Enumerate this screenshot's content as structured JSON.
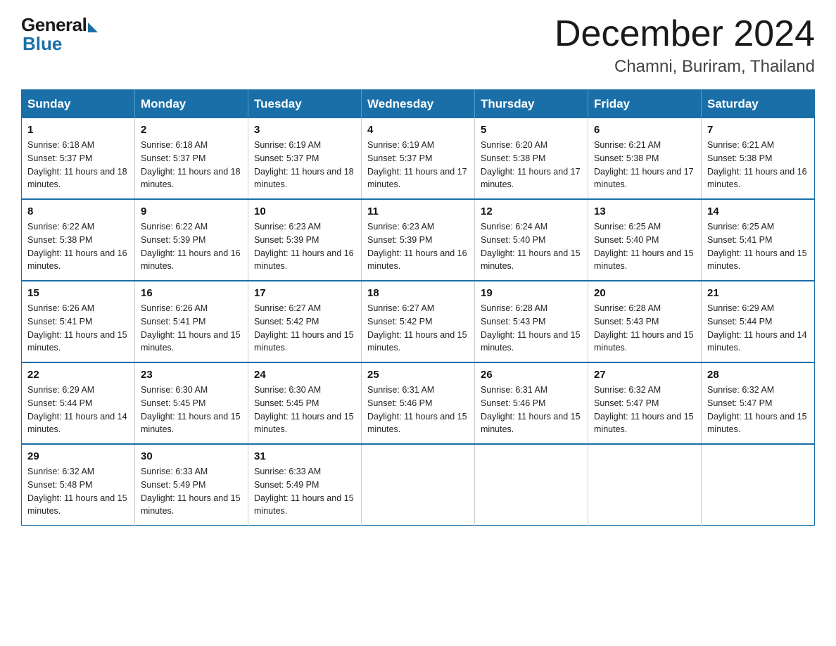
{
  "logo": {
    "general": "General",
    "blue": "Blue"
  },
  "header": {
    "month": "December 2024",
    "location": "Chamni, Buriram, Thailand"
  },
  "weekdays": [
    "Sunday",
    "Monday",
    "Tuesday",
    "Wednesday",
    "Thursday",
    "Friday",
    "Saturday"
  ],
  "weeks": [
    [
      {
        "day": "1",
        "sunrise": "6:18 AM",
        "sunset": "5:37 PM",
        "daylight": "11 hours and 18 minutes."
      },
      {
        "day": "2",
        "sunrise": "6:18 AM",
        "sunset": "5:37 PM",
        "daylight": "11 hours and 18 minutes."
      },
      {
        "day": "3",
        "sunrise": "6:19 AM",
        "sunset": "5:37 PM",
        "daylight": "11 hours and 18 minutes."
      },
      {
        "day": "4",
        "sunrise": "6:19 AM",
        "sunset": "5:37 PM",
        "daylight": "11 hours and 17 minutes."
      },
      {
        "day": "5",
        "sunrise": "6:20 AM",
        "sunset": "5:38 PM",
        "daylight": "11 hours and 17 minutes."
      },
      {
        "day": "6",
        "sunrise": "6:21 AM",
        "sunset": "5:38 PM",
        "daylight": "11 hours and 17 minutes."
      },
      {
        "day": "7",
        "sunrise": "6:21 AM",
        "sunset": "5:38 PM",
        "daylight": "11 hours and 16 minutes."
      }
    ],
    [
      {
        "day": "8",
        "sunrise": "6:22 AM",
        "sunset": "5:38 PM",
        "daylight": "11 hours and 16 minutes."
      },
      {
        "day": "9",
        "sunrise": "6:22 AM",
        "sunset": "5:39 PM",
        "daylight": "11 hours and 16 minutes."
      },
      {
        "day": "10",
        "sunrise": "6:23 AM",
        "sunset": "5:39 PM",
        "daylight": "11 hours and 16 minutes."
      },
      {
        "day": "11",
        "sunrise": "6:23 AM",
        "sunset": "5:39 PM",
        "daylight": "11 hours and 16 minutes."
      },
      {
        "day": "12",
        "sunrise": "6:24 AM",
        "sunset": "5:40 PM",
        "daylight": "11 hours and 15 minutes."
      },
      {
        "day": "13",
        "sunrise": "6:25 AM",
        "sunset": "5:40 PM",
        "daylight": "11 hours and 15 minutes."
      },
      {
        "day": "14",
        "sunrise": "6:25 AM",
        "sunset": "5:41 PM",
        "daylight": "11 hours and 15 minutes."
      }
    ],
    [
      {
        "day": "15",
        "sunrise": "6:26 AM",
        "sunset": "5:41 PM",
        "daylight": "11 hours and 15 minutes."
      },
      {
        "day": "16",
        "sunrise": "6:26 AM",
        "sunset": "5:41 PM",
        "daylight": "11 hours and 15 minutes."
      },
      {
        "day": "17",
        "sunrise": "6:27 AM",
        "sunset": "5:42 PM",
        "daylight": "11 hours and 15 minutes."
      },
      {
        "day": "18",
        "sunrise": "6:27 AM",
        "sunset": "5:42 PM",
        "daylight": "11 hours and 15 minutes."
      },
      {
        "day": "19",
        "sunrise": "6:28 AM",
        "sunset": "5:43 PM",
        "daylight": "11 hours and 15 minutes."
      },
      {
        "day": "20",
        "sunrise": "6:28 AM",
        "sunset": "5:43 PM",
        "daylight": "11 hours and 15 minutes."
      },
      {
        "day": "21",
        "sunrise": "6:29 AM",
        "sunset": "5:44 PM",
        "daylight": "11 hours and 14 minutes."
      }
    ],
    [
      {
        "day": "22",
        "sunrise": "6:29 AM",
        "sunset": "5:44 PM",
        "daylight": "11 hours and 14 minutes."
      },
      {
        "day": "23",
        "sunrise": "6:30 AM",
        "sunset": "5:45 PM",
        "daylight": "11 hours and 15 minutes."
      },
      {
        "day": "24",
        "sunrise": "6:30 AM",
        "sunset": "5:45 PM",
        "daylight": "11 hours and 15 minutes."
      },
      {
        "day": "25",
        "sunrise": "6:31 AM",
        "sunset": "5:46 PM",
        "daylight": "11 hours and 15 minutes."
      },
      {
        "day": "26",
        "sunrise": "6:31 AM",
        "sunset": "5:46 PM",
        "daylight": "11 hours and 15 minutes."
      },
      {
        "day": "27",
        "sunrise": "6:32 AM",
        "sunset": "5:47 PM",
        "daylight": "11 hours and 15 minutes."
      },
      {
        "day": "28",
        "sunrise": "6:32 AM",
        "sunset": "5:47 PM",
        "daylight": "11 hours and 15 minutes."
      }
    ],
    [
      {
        "day": "29",
        "sunrise": "6:32 AM",
        "sunset": "5:48 PM",
        "daylight": "11 hours and 15 minutes."
      },
      {
        "day": "30",
        "sunrise": "6:33 AM",
        "sunset": "5:49 PM",
        "daylight": "11 hours and 15 minutes."
      },
      {
        "day": "31",
        "sunrise": "6:33 AM",
        "sunset": "5:49 PM",
        "daylight": "11 hours and 15 minutes."
      },
      null,
      null,
      null,
      null
    ]
  ]
}
